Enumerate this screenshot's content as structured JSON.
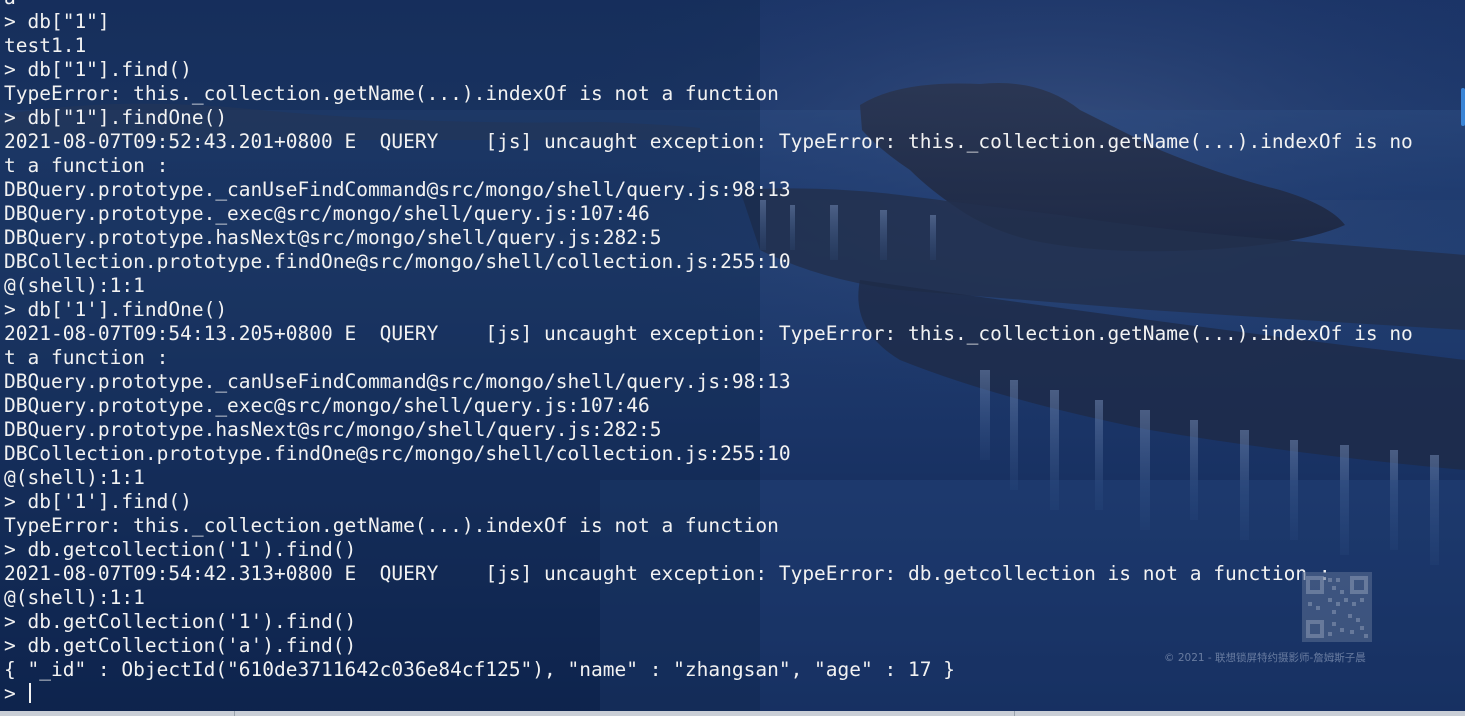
{
  "terminal": {
    "lines": [
      "a",
      "> db[\"1\"]",
      "test1.1",
      "> db[\"1\"].find()",
      "TypeError: this._collection.getName(...).indexOf is not a function",
      "> db[\"1\"].findOne()",
      "2021-08-07T09:52:43.201+0800 E  QUERY    [js] uncaught exception: TypeError: this._collection.getName(...).indexOf is no",
      "t a function :",
      "DBQuery.prototype._canUseFindCommand@src/mongo/shell/query.js:98:13",
      "DBQuery.prototype._exec@src/mongo/shell/query.js:107:46",
      "DBQuery.prototype.hasNext@src/mongo/shell/query.js:282:5",
      "DBCollection.prototype.findOne@src/mongo/shell/collection.js:255:10",
      "@(shell):1:1",
      "> db['1'].findOne()",
      "2021-08-07T09:54:13.205+0800 E  QUERY    [js] uncaught exception: TypeError: this._collection.getName(...).indexOf is no",
      "t a function :",
      "DBQuery.prototype._canUseFindCommand@src/mongo/shell/query.js:98:13",
      "DBQuery.prototype._exec@src/mongo/shell/query.js:107:46",
      "DBQuery.prototype.hasNext@src/mongo/shell/query.js:282:5",
      "DBCollection.prototype.findOne@src/mongo/shell/collection.js:255:10",
      "@(shell):1:1",
      "> db['1'].find()",
      "TypeError: this._collection.getName(...).indexOf is not a function",
      "> db.getcollection('1').find()",
      "2021-08-07T09:54:42.313+0800 E  QUERY    [js] uncaught exception: TypeError: db.getcollection is not a function :",
      "@(shell):1:1",
      "> db.getCollection('1').find()",
      "> db.getCollection('a').find()",
      "{ \"_id\" : ObjectId(\"610de3711642c036e84cf125\"), \"name\" : \"zhangsan\", \"age\" : 17 }"
    ],
    "prompt": "> ",
    "current_input": ""
  },
  "watermark": {
    "text": "© 2021 - 联想锁屏特约摄影师-詹姆斯子晨"
  },
  "colors": {
    "text": "#f2f2f2",
    "background": "#0f2547",
    "scroll_accent": "#3a84d6"
  }
}
